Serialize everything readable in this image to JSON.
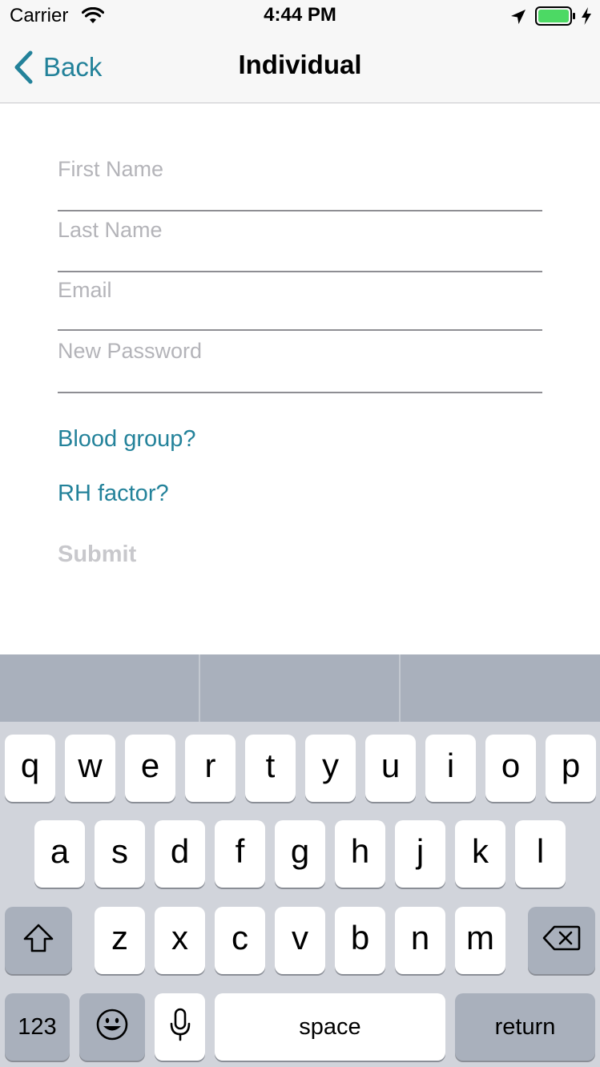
{
  "status_bar": {
    "carrier": "Carrier",
    "time": "4:44 PM",
    "battery_color": "#4cd964"
  },
  "nav": {
    "back_label": "Back",
    "title": "Individual"
  },
  "form": {
    "first_name_placeholder": "First Name",
    "last_name_placeholder": "Last Name",
    "email_placeholder": "Email",
    "password_placeholder": "New Password",
    "blood_group_label": "Blood group?",
    "rh_factor_label": "RH factor?",
    "submit_label": "Submit"
  },
  "keyboard": {
    "row1": [
      "q",
      "w",
      "e",
      "r",
      "t",
      "y",
      "u",
      "i",
      "o",
      "p"
    ],
    "row2": [
      "a",
      "s",
      "d",
      "f",
      "g",
      "h",
      "j",
      "k",
      "l"
    ],
    "row3": [
      "z",
      "x",
      "c",
      "v",
      "b",
      "n",
      "m"
    ],
    "numbers_label": "123",
    "space_label": "space",
    "return_label": "return"
  },
  "colors": {
    "accent": "#23829a",
    "placeholder": "#b4b4b9",
    "submit_disabled": "#c8c8cc"
  }
}
